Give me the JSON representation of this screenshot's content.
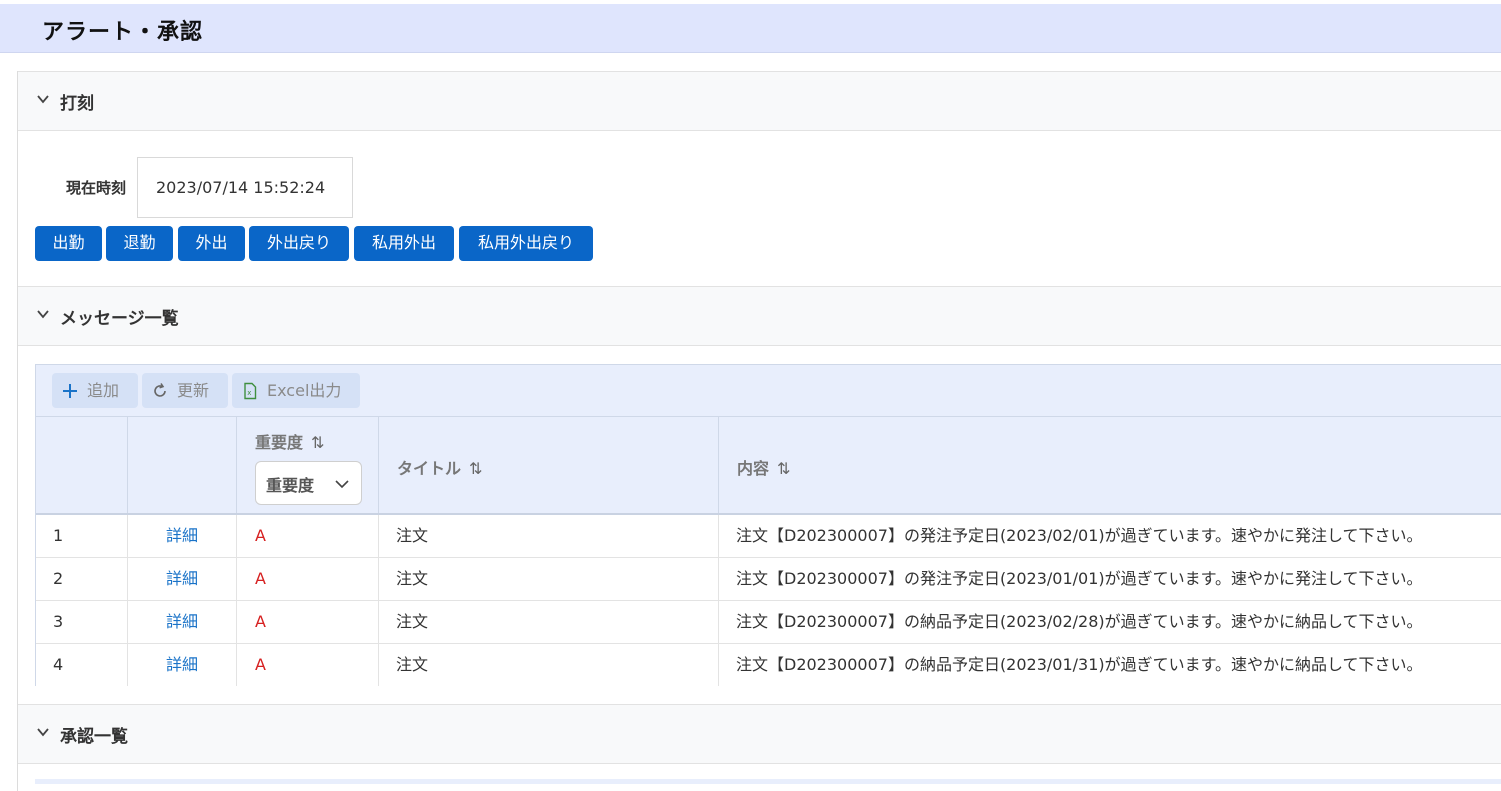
{
  "header": {
    "title": "アラート・承認"
  },
  "sections": {
    "punch": "打刻",
    "messages": "メッセージ一覧",
    "approvals": "承認一覧"
  },
  "clock": {
    "label": "現在時刻",
    "value": "2023/07/14 15:52:24"
  },
  "punch_buttons": [
    "出勤",
    "退勤",
    "外出",
    "外出戻り",
    "私用外出",
    "私用外出戻り"
  ],
  "toolbar": {
    "add": "追加",
    "refresh": "更新",
    "excel": "Excel出力"
  },
  "table": {
    "columns": {
      "severity": "重要度",
      "title": "タイトル",
      "content": "内容"
    },
    "severity_filter": "重要度",
    "rows": [
      {
        "no": "1",
        "detail": "詳細",
        "severity": "A",
        "title": "注文",
        "content": "注文【D202300007】の発注予定日(2023/02/01)が過ぎています。速やかに発注して下さい。"
      },
      {
        "no": "2",
        "detail": "詳細",
        "severity": "A",
        "title": "注文",
        "content": "注文【D202300007】の発注予定日(2023/01/01)が過ぎています。速やかに発注して下さい。"
      },
      {
        "no": "3",
        "detail": "詳細",
        "severity": "A",
        "title": "注文",
        "content": "注文【D202300007】の納品予定日(2023/02/28)が過ぎています。速やかに納品して下さい。"
      },
      {
        "no": "4",
        "detail": "詳細",
        "severity": "A",
        "title": "注文",
        "content": "注文【D202300007】の納品予定日(2023/01/31)が過ぎています。速やかに納品して下さい。"
      }
    ]
  },
  "colors": {
    "primary": "#0a66c8",
    "header_bg": "#dfe5fd",
    "severity_a": "#d62020",
    "link": "#1a73c8"
  }
}
